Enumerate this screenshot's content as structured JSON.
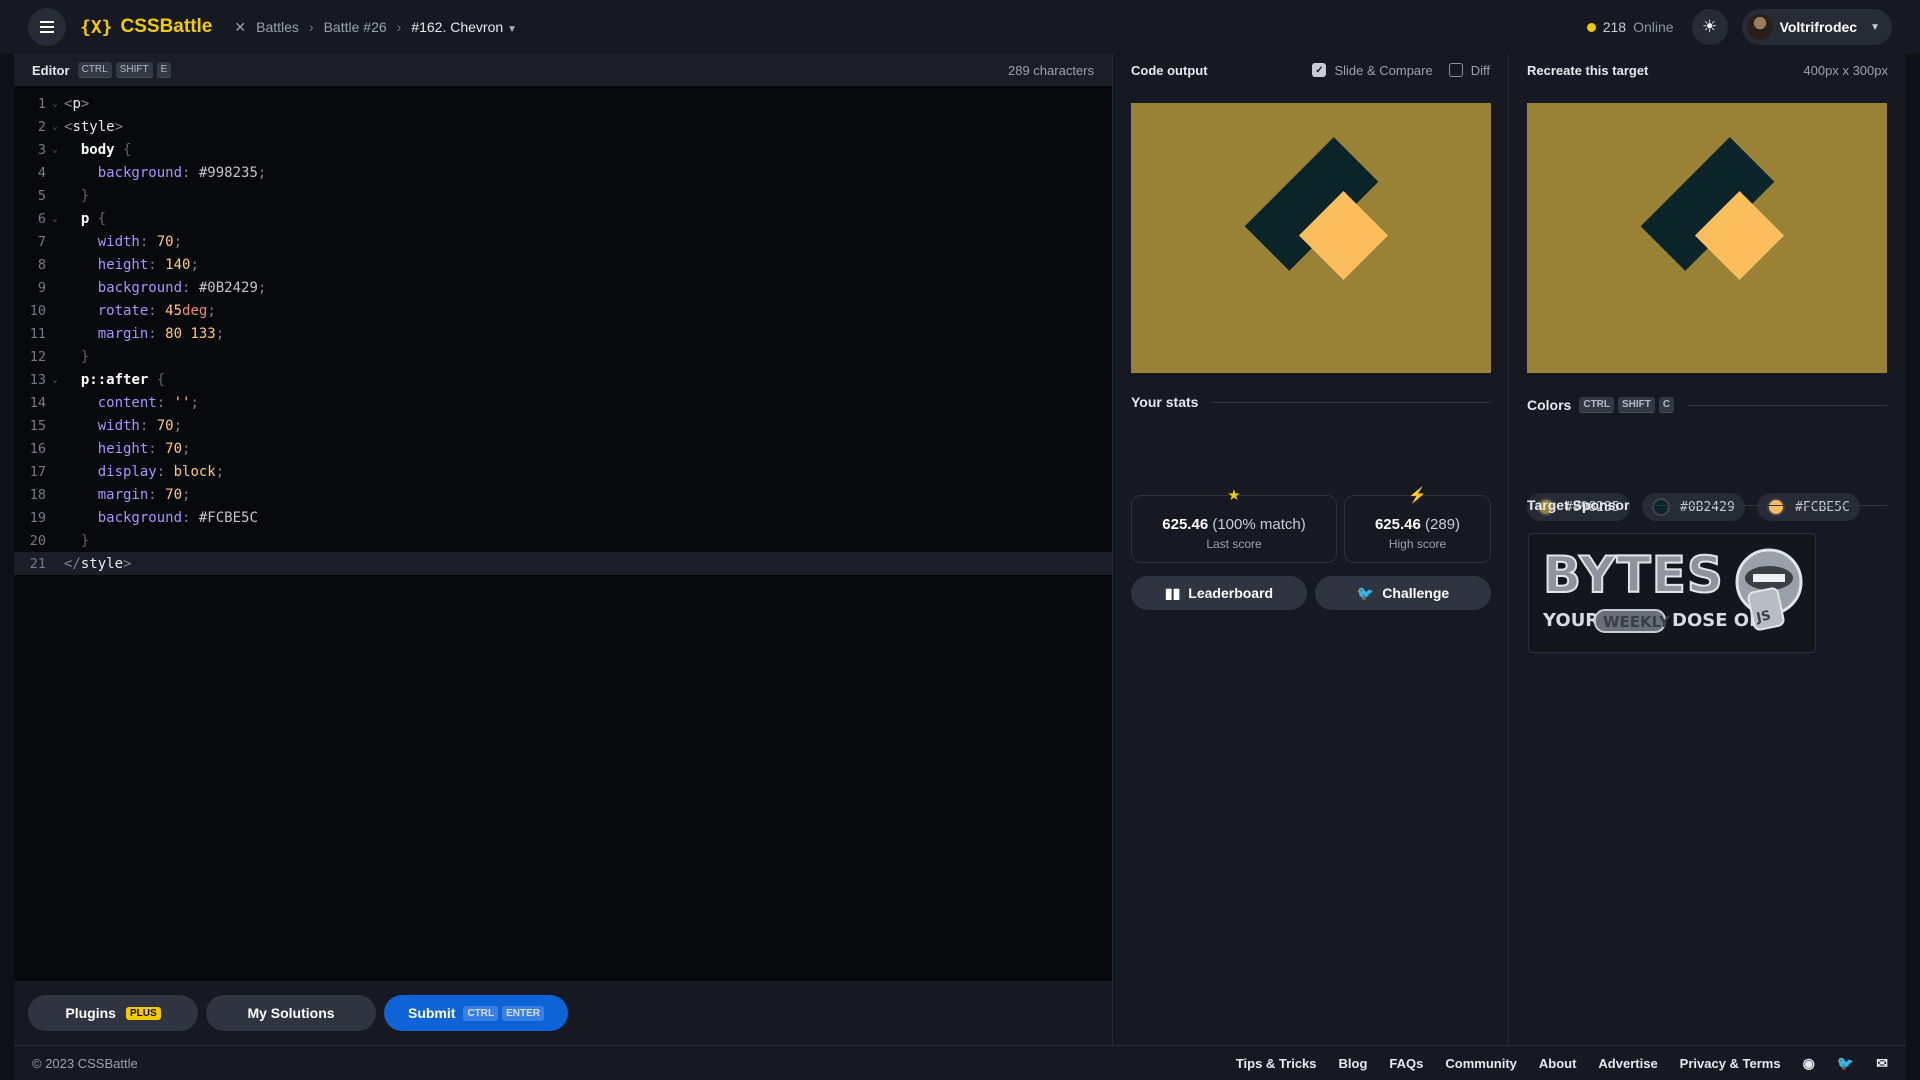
{
  "topbar": {
    "logo_mark": "{X}",
    "logo_text": "CSSBattle",
    "breadcrumbs": [
      "Battles",
      "Battle #26",
      "#162. Chevron"
    ],
    "online_count": "218",
    "online_label": "Online",
    "username": "Voltrifrodec"
  },
  "editor": {
    "title": "Editor",
    "shortcut": [
      "CTRL",
      "SHIFT",
      "E"
    ],
    "char_count": "289 characters",
    "lines": [
      {
        "n": "1",
        "fold": true
      },
      {
        "n": "2",
        "fold": true
      },
      {
        "n": "3",
        "fold": true
      },
      {
        "n": "4",
        "fold": false
      },
      {
        "n": "5",
        "fold": false
      },
      {
        "n": "6",
        "fold": true
      },
      {
        "n": "7",
        "fold": false
      },
      {
        "n": "8",
        "fold": false
      },
      {
        "n": "9",
        "fold": false
      },
      {
        "n": "10",
        "fold": false
      },
      {
        "n": "11",
        "fold": false
      },
      {
        "n": "12",
        "fold": false
      },
      {
        "n": "13",
        "fold": true
      },
      {
        "n": "14",
        "fold": false
      },
      {
        "n": "15",
        "fold": false
      },
      {
        "n": "16",
        "fold": false
      },
      {
        "n": "17",
        "fold": false
      },
      {
        "n": "18",
        "fold": false
      },
      {
        "n": "19",
        "fold": false
      },
      {
        "n": "20",
        "fold": false
      },
      {
        "n": "21",
        "fold": false
      }
    ],
    "code": {
      "l1": "p",
      "l2": "style",
      "l3_sel": "body",
      "l4_prop": "background",
      "l4_val": "#998235",
      "l6_sel": "p",
      "l7_prop": "width",
      "l7_val": "70",
      "l8_prop": "height",
      "l8_val": "140",
      "l9_prop": "background",
      "l9_val": "#0B2429",
      "l10_prop": "rotate",
      "l10_num": "45",
      "l10_unit": "deg",
      "l11_prop": "margin",
      "l11_val": "80 133",
      "l13_sel": "p",
      "l13_pseudo": "::after",
      "l14_prop": "content",
      "l14_val": "''",
      "l15_prop": "width",
      "l15_val": "70",
      "l16_prop": "height",
      "l16_val": "70",
      "l17_prop": "display",
      "l17_val": "block",
      "l18_prop": "margin",
      "l18_val": "70",
      "l19_prop": "background",
      "l19_val": "#FCBE5C",
      "l21": "style"
    },
    "footer": {
      "plugins": "Plugins",
      "plus_badge": "PLUS",
      "solutions": "My Solutions",
      "submit": "Submit",
      "submit_keys": [
        "CTRL",
        "ENTER"
      ]
    }
  },
  "output": {
    "title": "Code output",
    "slide_compare": "Slide & Compare",
    "slide_compare_checked": true,
    "diff": "Diff",
    "diff_checked": false,
    "stats_title": "Your stats",
    "last_score": "625.46",
    "last_score_detail": "(100% match)",
    "last_score_label": "Last score",
    "high_score": "625.46",
    "high_score_detail": "(289)",
    "high_score_label": "High score",
    "leaderboard": "Leaderboard",
    "challenge": "Challenge"
  },
  "target": {
    "title": "Recreate this target",
    "size": "400px x 300px",
    "colors_title": "Colors",
    "colors_keys": [
      "CTRL",
      "SHIFT",
      "C"
    ],
    "colors": [
      "#998235",
      "#0B2429",
      "#FCBE5C"
    ],
    "sponsor_title": "Target Sponsor",
    "sponsor_word": "BYTES",
    "sponsor_line": [
      "YOUR",
      "WEEKLY",
      "DOSE OF"
    ],
    "sponsor_badge": "JS"
  },
  "footer": {
    "copyright": "© 2023 CSSBattle",
    "links": [
      "Tips & Tricks",
      "Blog",
      "FAQs",
      "Community",
      "About",
      "Advertise",
      "Privacy & Terms"
    ]
  },
  "theme": {
    "accent": "#f2cb05",
    "submit": "#0e63d6",
    "canvas_bg": "#998235",
    "dark": "#0B2429",
    "light": "#FCBE5C"
  }
}
